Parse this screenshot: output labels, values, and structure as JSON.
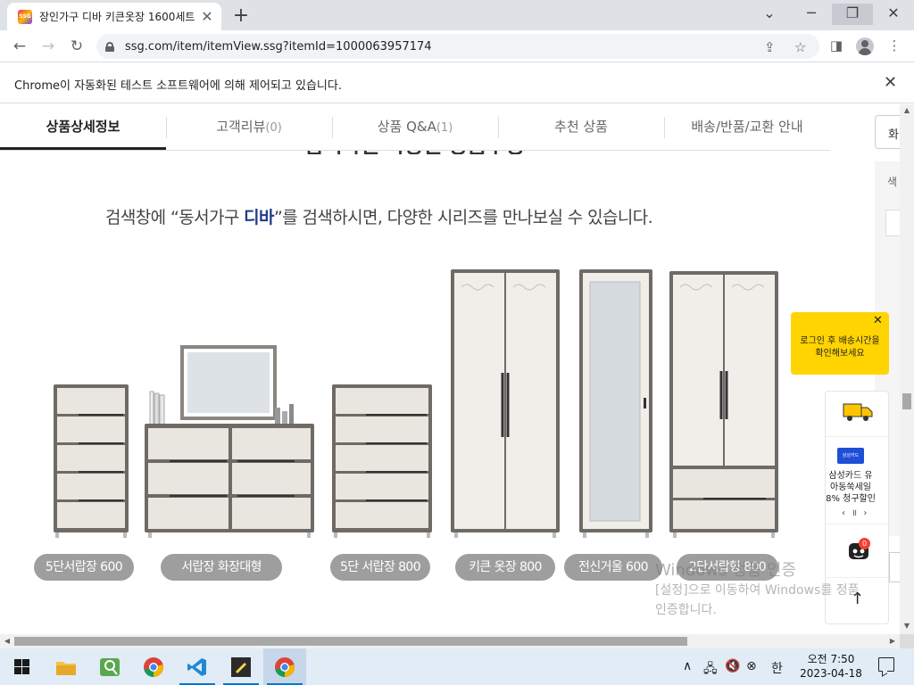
{
  "browser": {
    "tab_title": "장인가구 디바 키큰옷장 1600세트",
    "favicon_text": "SSG",
    "url": "ssg.com/item/itemView.ssg?itemId=1000063957174",
    "infobar_text": "Chrome이 자동화된 테스트 소프트웨어에 의해 제어되고 있습니다."
  },
  "product_tabs": [
    {
      "label": "상품상세정보",
      "count": ""
    },
    {
      "label": "고객리뷰",
      "count": "(0)"
    },
    {
      "label": "상품 Q&A",
      "count": "(1)"
    },
    {
      "label": "추천 상품",
      "count": ""
    },
    {
      "label": "배송/반품/교환 안내",
      "count": ""
    }
  ],
  "right_search": {
    "button_label": "화",
    "panel_label": "색"
  },
  "detail": {
    "cut_heading": "검색하면 다양한 상품구성",
    "search_msg_prefix": "검색창에 “동서가구 ",
    "search_msg_brand": "디바",
    "search_msg_suffix": "”를 검색하시면, 다양한 시리즈를 만나보실 수 있습니다.",
    "products": [
      {
        "label": "5단서랍장 600"
      },
      {
        "label": "서랍장 화장대형"
      },
      {
        "label": "5단 서랍장 800"
      },
      {
        "label": "키큰 옷장 800"
      },
      {
        "label": "전신거울 600"
      },
      {
        "label": "2단서랍형 800"
      }
    ]
  },
  "floating": {
    "tooltip_text": "로그인 후 배송시간을 확인해보세요",
    "card_logo": "삼성카드",
    "card_text": "삼성카드 유아동쑥세일 8% 청구할인",
    "card_nav": "‹ ॥ ›",
    "chat_badge": "0"
  },
  "watermark": {
    "line1": "Windows 정품 인증",
    "line2": "[설정]으로 이동하여 Windows를 정품",
    "line3": "인증합니다."
  },
  "taskbar": {
    "time": "오전 7:50",
    "date": "2023-04-18",
    "ime": "한"
  },
  "colors": {
    "accent_brand": "#1e3a8a",
    "pill": "#9e9e9e",
    "tooltip": "#ffd400",
    "taskbar": "#e1ecf7"
  }
}
